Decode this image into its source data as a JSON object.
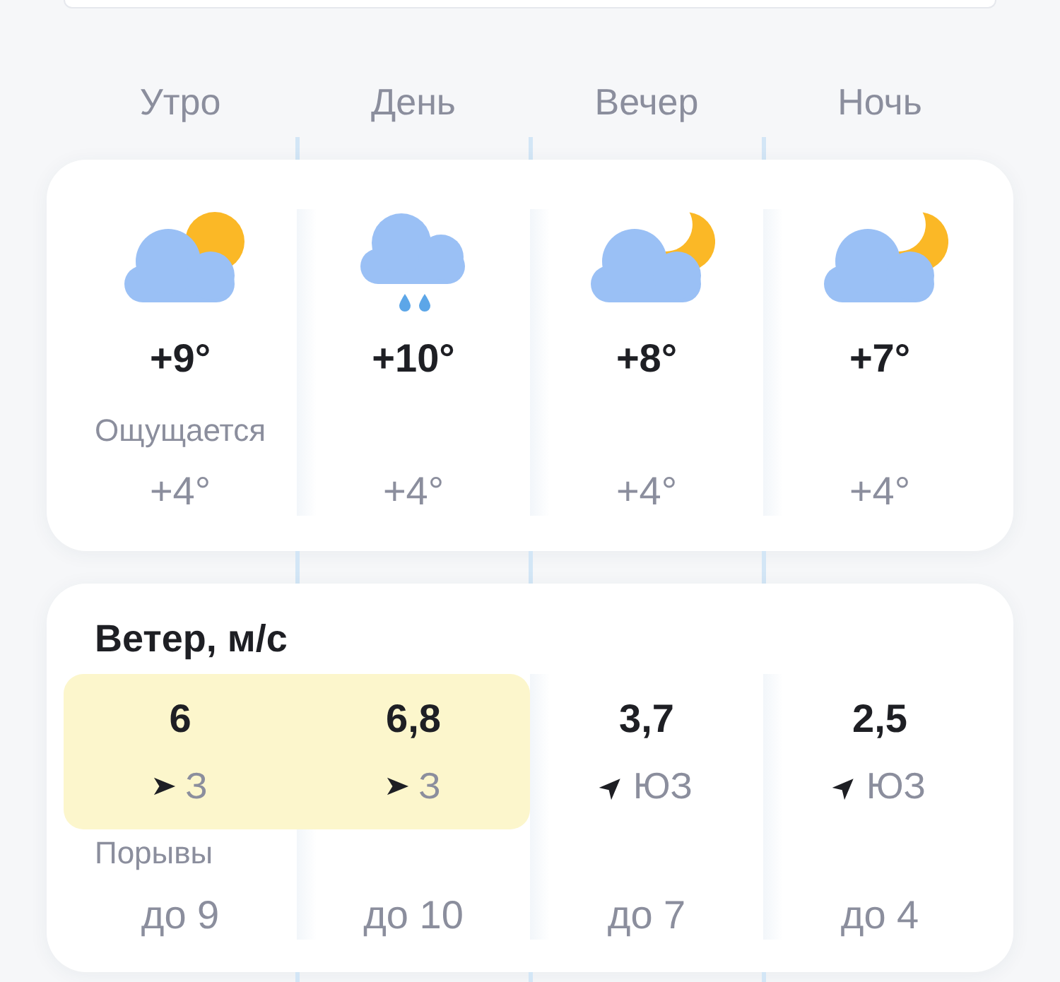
{
  "periods": [
    {
      "label": "Утро",
      "kind": "sun",
      "temperature": "+9°",
      "feels_like": "+4°"
    },
    {
      "label": "День",
      "kind": "rain",
      "temperature": "+10°",
      "feels_like": "+4°"
    },
    {
      "label": "Вечер",
      "kind": "moon",
      "temperature": "+8°",
      "feels_like": "+4°"
    },
    {
      "label": "Ночь",
      "kind": "moon",
      "temperature": "+7°",
      "feels_like": "+4°"
    }
  ],
  "feels_like_label": "Ощущается",
  "wind": {
    "title": "Ветер, м/с",
    "gusts_label": "Порывы",
    "items": [
      {
        "speed": "6",
        "kind": "east",
        "direction": "З",
        "highlighted": true,
        "gusts": "до 9"
      },
      {
        "speed": "6,8",
        "kind": "east",
        "direction": "З",
        "highlighted": true,
        "gusts": "до 10"
      },
      {
        "speed": "3,7",
        "kind": "northeast",
        "direction": "ЮЗ",
        "highlighted": false,
        "gusts": "до 7"
      },
      {
        "speed": "2,5",
        "kind": "northeast",
        "direction": "ЮЗ",
        "highlighted": false,
        "gusts": "до 4"
      }
    ]
  }
}
